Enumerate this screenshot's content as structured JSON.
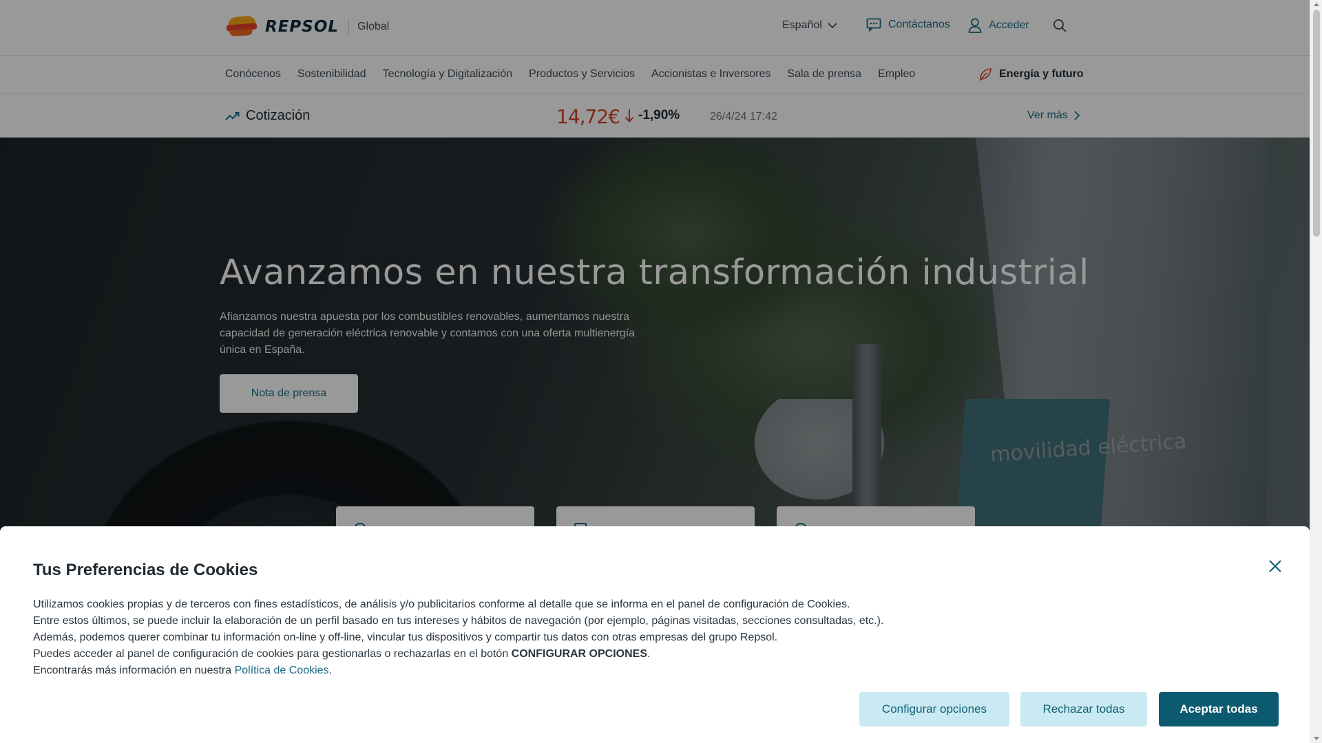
{
  "header": {
    "brand": "REPSOL",
    "region": "Global",
    "language": "Español",
    "contact_label": "Contáctanos",
    "login_label": "Acceder"
  },
  "nav": {
    "items": [
      {
        "label": "Conócenos"
      },
      {
        "label": "Sostenibilidad"
      },
      {
        "label": "Tecnología y Digitalización"
      },
      {
        "label": "Productos y Servicios"
      },
      {
        "label": "Accionistas e Inversores"
      },
      {
        "label": "Sala de prensa"
      },
      {
        "label": "Empleo"
      }
    ],
    "energy_label": "Energía y futuro"
  },
  "stock": {
    "title": "Cotización",
    "price": "14,72€",
    "change": "-1,90%",
    "datetime": "26/4/24 17:42",
    "more_label": "Ver más"
  },
  "hero": {
    "title": "Avanzamos en nuestra transformación industrial",
    "text": "Afianzamos nuestra apuesta por los combustibles renovables, aumentamos nuestra capacidad de generación eléctrica renovable y contamos con una oferta multienergía única en España.",
    "button_label": "Nota de prensa",
    "image_sign": "movilidad eléctrica"
  },
  "cookie": {
    "title": "Tus Preferencias de Cookies",
    "line1": "Utilizamos cookies propias y de terceros con fines estadísticos, de análisis y/o publicitarios conforme al detalle que se informa en el panel de configuración de Cookies.",
    "line2": "Entre estos últimos, se puede incluir la elaboración de un perfil basado en tus intereses y hábitos de navegación (por ejemplo, páginas visitadas, secciones consultadas, etc.).",
    "line3": "Además, podemos querer combinar tu información on-line y off-line, vincular tus dispositivos y compartir tus datos con otras empresas del grupo Repsol.",
    "line4_prefix": "Puedes acceder al panel de configuración de cookies para gestionarlas o rechazarlas en el botón ",
    "line4_bold": "CONFIGURAR OPCIONES",
    "line4_suffix": ".",
    "line5_prefix": "Encontrarás más información en nuestra ",
    "line5_link": "Política de Cookies",
    "line5_suffix": ".",
    "config_label": "Configurar opciones",
    "reject_label": "Rechazar todas",
    "accept_label": "Aceptar todas"
  },
  "colors": {
    "accent": "#1a6d87",
    "accept_button": "#0b5a70",
    "secondary_button": "#c9eaf2",
    "price_down": "#d2442a"
  },
  "icons": [
    "chevron-down-icon",
    "chat-icon",
    "user-icon",
    "search-icon",
    "leaf-icon",
    "trend-icon",
    "arrow-down-icon",
    "chevron-right-icon",
    "close-icon"
  ]
}
